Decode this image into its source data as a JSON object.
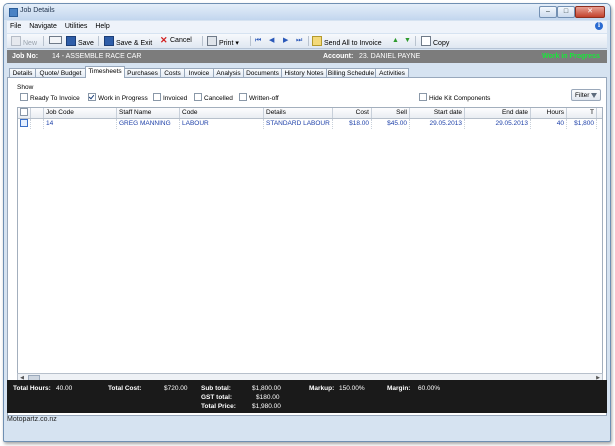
{
  "window": {
    "title": "Job Details",
    "min": "–",
    "max": "□",
    "close": "✕"
  },
  "menu": [
    "File",
    "Navigate",
    "Utilities",
    "Help"
  ],
  "toolbar": {
    "new": "New",
    "save": "Save",
    "save_exit": "Save & Exit",
    "cancel": "Cancel",
    "print": "Print",
    "send_all": "Send All to Invoice",
    "copy": "Copy"
  },
  "job": {
    "job_no_label": "Job No:",
    "job_no_value": "14 - ASSEMBLE RACE CAR",
    "account_label": "Account:",
    "account_value": "23. DANIEL PAYNE",
    "status": "Work in Progress",
    "status_color": "#19e63a"
  },
  "tabs": [
    "Details",
    "Quote/ Budget",
    "Timesheets",
    "Purchases",
    "Costs",
    "Invoice",
    "Analysis",
    "Documents",
    "History Notes",
    "Billing Schedule",
    "Activities"
  ],
  "active_tab": "Timesheets",
  "show": {
    "label": "Show",
    "filters": [
      {
        "label": "Ready To Invoice",
        "checked": false
      },
      {
        "label": "Work in Progress",
        "checked": true
      },
      {
        "label": "Invoiced",
        "checked": false
      },
      {
        "label": "Cancelled",
        "checked": false
      },
      {
        "label": "Written-off",
        "checked": false
      }
    ],
    "hide_kit": "Hide Kit Components",
    "filter_button": "Filter"
  },
  "grid": {
    "columns": [
      "Job Code",
      "Staff Name",
      "Code",
      "Details",
      "Cost",
      "Sell",
      "Start date",
      "End date",
      "Hours",
      "T"
    ],
    "rows": [
      {
        "job_code": "14",
        "staff": "GREG MANNING",
        "code": "LABOUR",
        "details": "STANDARD LABOUR ...",
        "cost": "$18.00",
        "sell": "$45.00",
        "start": "29.05.2013",
        "end": "29.05.2013",
        "hours": "40",
        "total": "$1,800"
      }
    ]
  },
  "totals": {
    "hours_label": "Total Hours:",
    "hours_value": "40.00",
    "cost_label": "Total Cost:",
    "cost_value": "$720.00",
    "subtotal_label": "Sub total:",
    "subtotal_value": "$1,800.00",
    "gst_label": "GST total:",
    "gst_value": "$180.00",
    "price_label": "Total Price:",
    "price_value": "$1,980.00",
    "markup_label": "Markup:",
    "markup_value": "150.00%",
    "margin_label": "Margin:",
    "margin_value": "60.00%"
  },
  "statusbar": {
    "text": "Motopartz.co.nz"
  }
}
